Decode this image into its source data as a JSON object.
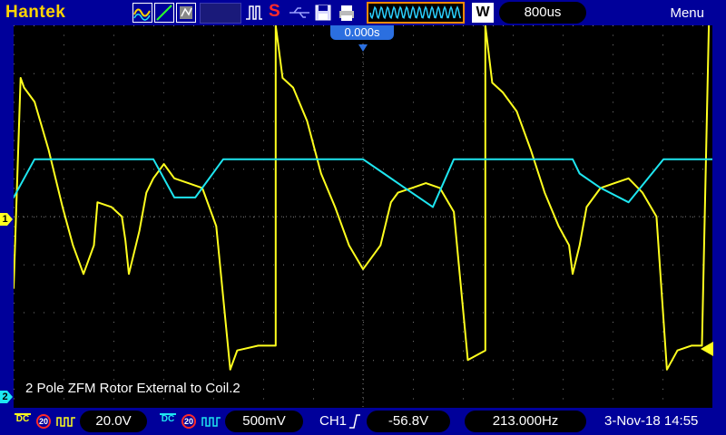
{
  "header": {
    "brand": "Hantek",
    "timebase": "800us",
    "wave_mode": "W",
    "menu": "Menu",
    "trigger_position": "0.000s"
  },
  "footer": {
    "ch1": {
      "coupling": "DC",
      "bw_limit": "20",
      "volts_div": "20.0V"
    },
    "ch2": {
      "coupling": "DC",
      "bw_limit": "20",
      "volts_div": "500mV"
    },
    "trigger": {
      "source": "CH1",
      "level": "-56.8V"
    },
    "frequency": "213.000Hz",
    "datetime": "3-Nov-18 14:55"
  },
  "markers": {
    "ch1": "1",
    "ch2": "2"
  },
  "screen": {
    "caption": "2 Pole ZFM Rotor External to Coil.2"
  },
  "colors": {
    "ch1": "#ffff1e",
    "ch2": "#1ee6f0",
    "background": "#00009a",
    "grid_dot": "#7a7a7a",
    "trigger_time_bg": "#2b6fe0"
  },
  "chart_data": {
    "type": "line",
    "series": [
      {
        "x": [
          0.0,
          0.1,
          0.15,
          0.3,
          0.5,
          0.7,
          0.85,
          1.0,
          1.15,
          1.2,
          1.4,
          1.55,
          1.6,
          1.65,
          1.8,
          1.9,
          2.0,
          2.1,
          2.15,
          2.3,
          2.5,
          2.7,
          2.9,
          3.1,
          3.2,
          3.5,
          3.75,
          3.75,
          3.85,
          4.0,
          4.2,
          4.4,
          4.6,
          4.8,
          5.0,
          5.05,
          5.25,
          5.4,
          5.5,
          5.7,
          5.9,
          6.1,
          6.3,
          6.5,
          6.75,
          6.75,
          6.85,
          7.0,
          7.2,
          7.4,
          7.6,
          7.8,
          7.95,
          8.0,
          8.1,
          8.2,
          8.4,
          8.6,
          8.8,
          9.0,
          9.2,
          9.35,
          9.5,
          9.7,
          9.85,
          9.95
        ],
        "values": [
          -1.5,
          2.9,
          2.7,
          2.4,
          1.4,
          0.2,
          -0.6,
          -1.2,
          -0.6,
          0.3,
          0.2,
          0.0,
          -0.5,
          -1.2,
          -0.3,
          0.5,
          0.8,
          1.0,
          1.1,
          0.8,
          0.7,
          0.6,
          -0.2,
          -3.2,
          -2.8,
          -2.7,
          -2.7,
          4.0,
          2.9,
          2.7,
          2.0,
          0.9,
          0.2,
          -0.6,
          -1.1,
          -1.0,
          -0.6,
          0.3,
          0.5,
          0.6,
          0.7,
          0.6,
          0.1,
          -3.0,
          -2.8,
          4.0,
          2.8,
          2.6,
          2.2,
          1.4,
          0.5,
          -0.2,
          -0.6,
          -1.2,
          -0.6,
          0.2,
          0.6,
          0.7,
          0.8,
          0.5,
          0.0,
          -3.2,
          -2.8,
          -2.7,
          -2.7,
          4.0
        ]
      },
      {
        "x": [
          0.0,
          0.3,
          1.0,
          1.5,
          2.0,
          2.3,
          2.6,
          3.0,
          3.25,
          3.5,
          4.0,
          4.5,
          5.0,
          5.3,
          5.6,
          6.0,
          6.3,
          6.6,
          6.9,
          7.0,
          7.4,
          7.8,
          8.0,
          8.1,
          8.4,
          8.8,
          9.3,
          9.6,
          10.0
        ],
        "values": [
          0.4,
          1.2,
          1.2,
          1.2,
          1.2,
          0.4,
          0.4,
          1.2,
          1.2,
          1.2,
          1.2,
          1.2,
          1.2,
          0.9,
          0.6,
          0.2,
          1.2,
          1.2,
          1.2,
          1.2,
          1.2,
          1.2,
          1.2,
          0.9,
          0.6,
          0.3,
          1.2,
          1.2,
          1.2
        ]
      }
    ],
    "xlim": [
      0,
      10
    ],
    "ylim": [
      -4,
      4
    ],
    "grid": true
  }
}
